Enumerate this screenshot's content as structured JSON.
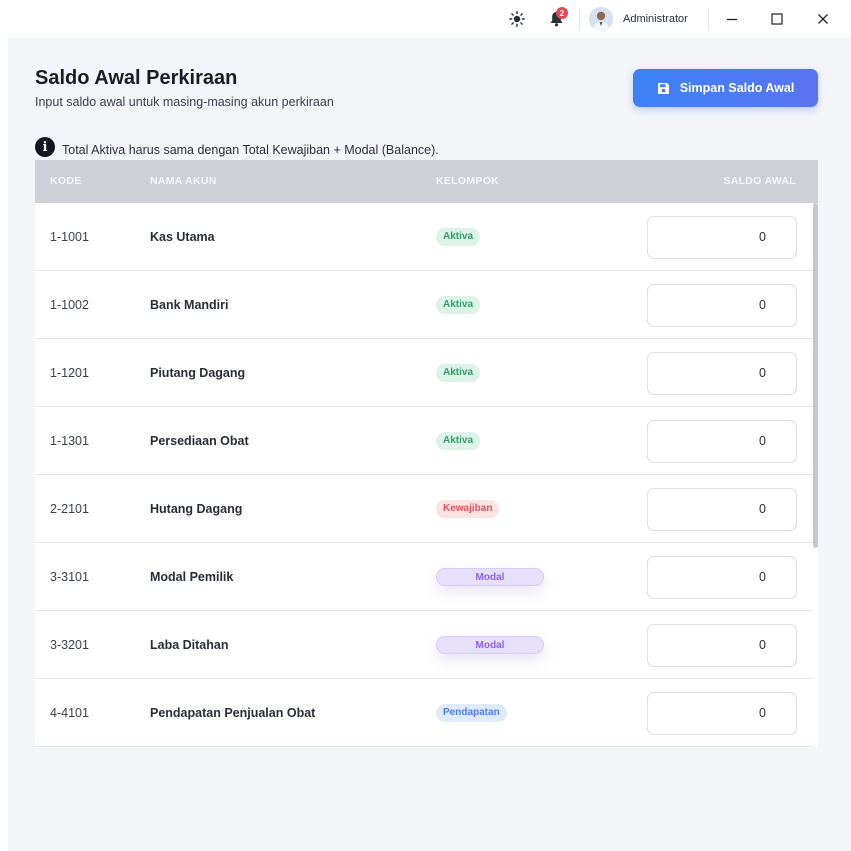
{
  "titlebar": {
    "theme_icon": "sun-icon",
    "notification_icon": "bell-icon",
    "notification_count": "2",
    "username": "Administrator",
    "minimize_glyph": "—",
    "maximize_glyph": "☐",
    "close_glyph": "✕"
  },
  "page": {
    "title": "Saldo Awal Perkiraan",
    "subtitle": "Input saldo awal untuk masing-masing akun perkiraan",
    "save_button_label": "Simpan Saldo Awal",
    "info_text": "Total Aktiva harus sama dengan Total Kewajiban + Modal (Balance)."
  },
  "table": {
    "headers": {
      "kode": "KODE",
      "nama": "NAMA AKUN",
      "kelompok": "KELOMPOK",
      "saldo": "SALDO AWAL"
    },
    "rows": [
      {
        "kode": "1-1001",
        "nama": "Kas Utama",
        "kelompok": "Aktiva",
        "saldo": "0"
      },
      {
        "kode": "1-1002",
        "nama": "Bank Mandiri",
        "kelompok": "Aktiva",
        "saldo": "0"
      },
      {
        "kode": "1-1201",
        "nama": "Piutang Dagang",
        "kelompok": "Aktiva",
        "saldo": "0"
      },
      {
        "kode": "1-1301",
        "nama": "Persediaan Obat",
        "kelompok": "Aktiva",
        "saldo": "0"
      },
      {
        "kode": "2-2101",
        "nama": "Hutang Dagang",
        "kelompok": "Kewajiban",
        "saldo": "0"
      },
      {
        "kode": "3-3101",
        "nama": "Modal Pemilik",
        "kelompok": "Modal",
        "saldo": "0"
      },
      {
        "kode": "3-3201",
        "nama": "Laba Ditahan",
        "kelompok": "Modal",
        "saldo": "0"
      },
      {
        "kode": "4-4101",
        "nama": "Pendapatan Penjualan Obat",
        "kelompok": "Pendapatan",
        "saldo": "0"
      }
    ]
  },
  "colors": {
    "accent": "#3b82f6",
    "aktiva": "#2aa26a",
    "kewajiban": "#e0545a",
    "modal": "#8a63e8",
    "pendapatan": "#4b82ef"
  }
}
